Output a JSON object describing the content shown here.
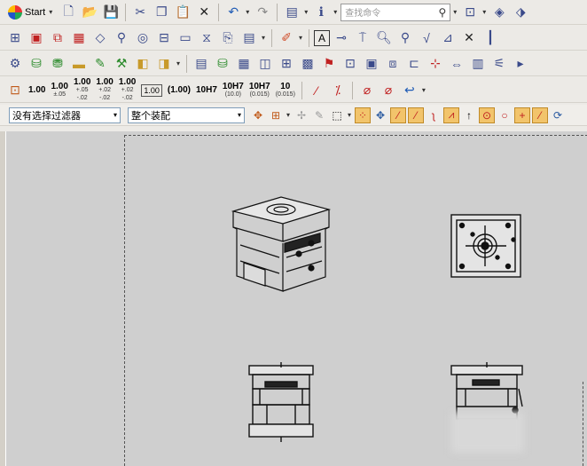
{
  "toolbar_row1": {
    "start_label": "Start",
    "search_placeholder": "查找命令",
    "buttons": [
      "new-document",
      "open-folder",
      "save",
      "cut",
      "copy",
      "paste",
      "delete",
      "undo",
      "redo",
      "window-list",
      "info"
    ]
  },
  "tolerance_labels": [
    "1.00",
    "±.05",
    "1.00",
    "+.05",
    "-.02",
    "1.00",
    "+.02",
    "-.02",
    "1.00",
    "+.02",
    "-.02",
    "1.00",
    "(1.00)",
    "10H7",
    "10H7",
    "(10.0)",
    "10H7",
    "(0.015)",
    "10",
    "(0.015)"
  ],
  "filter": {
    "selected": "没有选择过滤器"
  },
  "assembly": {
    "selected": "整个装配"
  },
  "canvas": {
    "background": "#cfcfcf",
    "views": [
      "isometric-view",
      "top-view",
      "front-view",
      "side-view"
    ]
  }
}
